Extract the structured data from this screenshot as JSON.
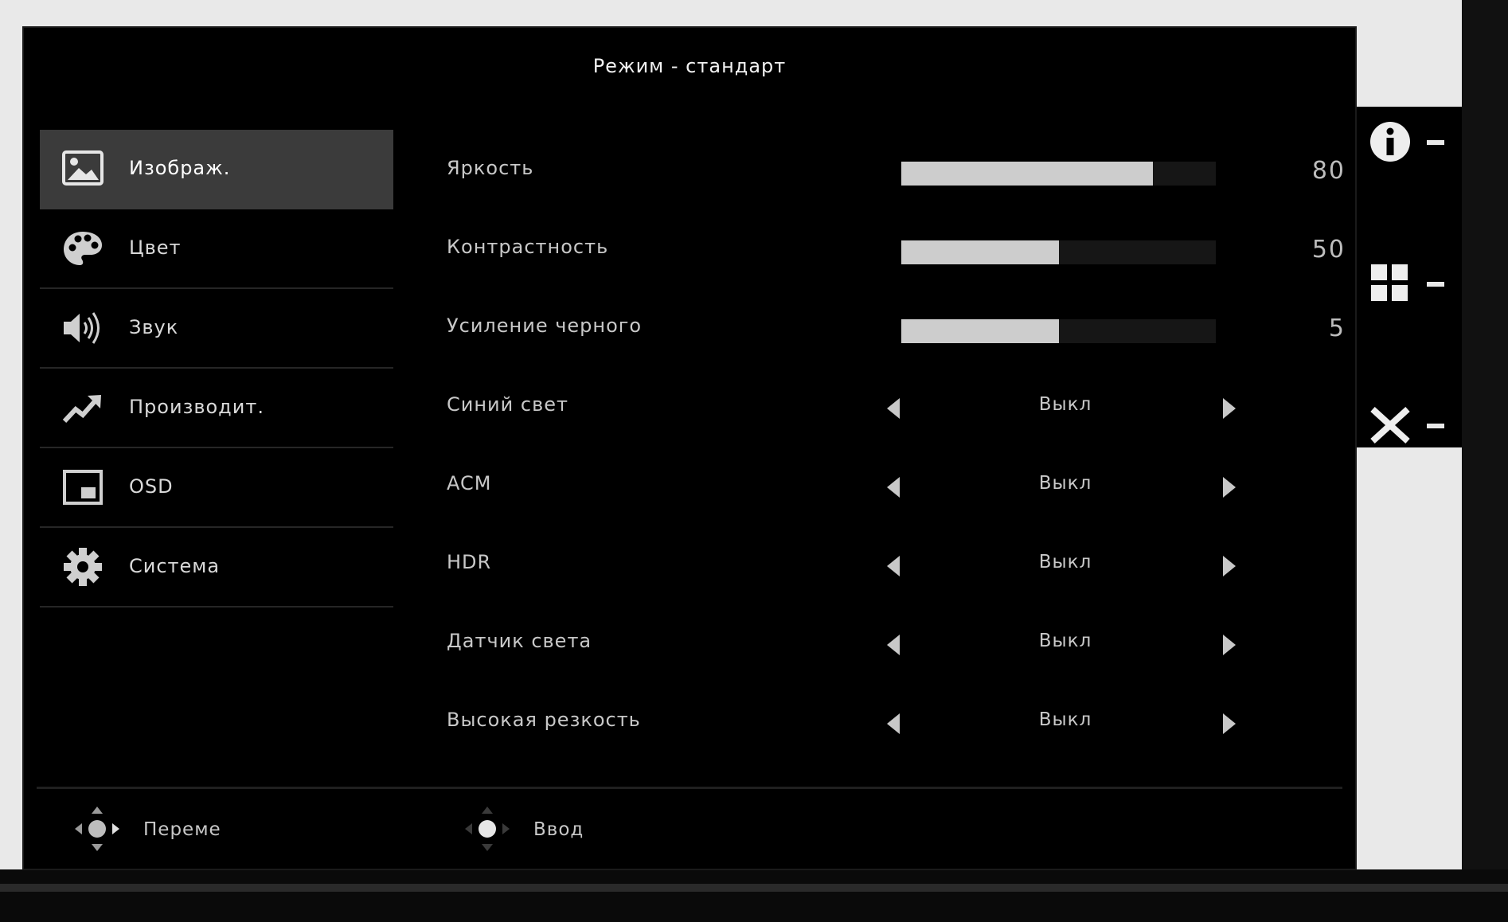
{
  "osd": {
    "title": "Режим - стандарт"
  },
  "sidebar": {
    "items": [
      {
        "label": "Изображ.",
        "icon": "picture-icon",
        "active": true
      },
      {
        "label": "Цвет",
        "icon": "palette-icon",
        "active": false
      },
      {
        "label": "Звук",
        "icon": "speaker-icon",
        "active": false
      },
      {
        "label": "Производит.",
        "icon": "trend-arrow-icon",
        "active": false
      },
      {
        "label": "OSD",
        "icon": "osd-window-icon",
        "active": false
      },
      {
        "label": "Система",
        "icon": "gear-icon",
        "active": false
      }
    ]
  },
  "settings": {
    "sliders": [
      {
        "label": "Яркость",
        "value": "80",
        "fill_percent": 80
      },
      {
        "label": "Контрастность",
        "value": "50",
        "fill_percent": 50
      },
      {
        "label": "Усиление черного",
        "value": "5",
        "fill_percent": 50
      }
    ],
    "options": [
      {
        "label": "Синий свет",
        "value": "Выкл"
      },
      {
        "label": "ACM",
        "value": "Выкл"
      },
      {
        "label": "HDR",
        "value": "Выкл"
      },
      {
        "label": "Датчик света",
        "value": "Выкл"
      },
      {
        "label": "Высокая резкость",
        "value": "Выкл"
      }
    ]
  },
  "footer": {
    "move_label": "Переме",
    "enter_label": "Ввод",
    "move_icon": "joystick-move-icon",
    "enter_icon": "joystick-press-icon"
  },
  "hotkeys": [
    {
      "icon": "info-icon"
    },
    {
      "icon": "grid-icon"
    },
    {
      "icon": "close-icon"
    }
  ],
  "colors": {
    "background": "#000000",
    "active_item": "#3b3b3b",
    "bar_fill": "#cdcdcd",
    "text": "#c8c8c8"
  }
}
